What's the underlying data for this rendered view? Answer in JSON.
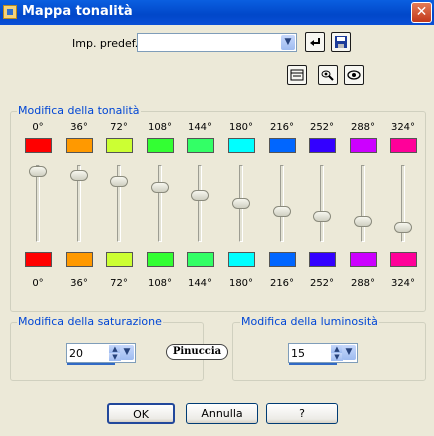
{
  "window": {
    "title": "Mappa tonalità",
    "close_glyph": "✕"
  },
  "presets": {
    "label": "Imp. predef.:",
    "value": "",
    "buttons": [
      {
        "name": "reset-icon"
      },
      {
        "name": "save-icon"
      },
      {
        "name": "toggle-preview-icon"
      },
      {
        "name": "proof-icon"
      },
      {
        "name": "eye-icon"
      }
    ]
  },
  "hue_group": {
    "title": "Modifica della tonalità",
    "channels": [
      {
        "label": "0°",
        "color": "#ff0000",
        "level": 0.98
      },
      {
        "label": "36°",
        "color": "#ff9900",
        "level": 0.92
      },
      {
        "label": "72°",
        "color": "#ccff33",
        "level": 0.83
      },
      {
        "label": "108°",
        "color": "#33ff33",
        "level": 0.74
      },
      {
        "label": "144°",
        "color": "#33ff66",
        "level": 0.62
      },
      {
        "label": "180°",
        "color": "#00ffff",
        "level": 0.5
      },
      {
        "label": "216°",
        "color": "#0066ff",
        "level": 0.38
      },
      {
        "label": "252°",
        "color": "#3300ff",
        "level": 0.3
      },
      {
        "label": "288°",
        "color": "#cc00ff",
        "level": 0.22
      },
      {
        "label": "324°",
        "color": "#ff0099",
        "level": 0.14
      }
    ]
  },
  "saturation": {
    "title": "Modifica della saturazione",
    "value": "20"
  },
  "luminosity": {
    "title": "Modifica della luminosità",
    "value": "15"
  },
  "buttons": {
    "ok": "OK",
    "cancel": "Annulla",
    "help": "?"
  }
}
